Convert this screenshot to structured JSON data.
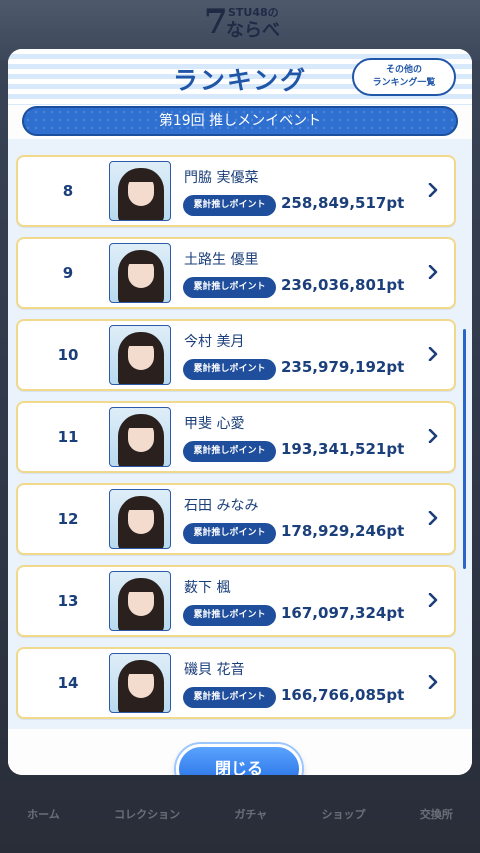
{
  "app": {
    "logo_small": "STU48の",
    "logo_number": "7",
    "logo_kana": "ならべ"
  },
  "bottom_nav": [
    {
      "label": "ホーム"
    },
    {
      "label": "コレクション"
    },
    {
      "label": "ガチャ"
    },
    {
      "label": "ショップ"
    },
    {
      "label": "交換所"
    }
  ],
  "modal": {
    "title": "ランキング",
    "other_ranking_line1": "その他の",
    "other_ranking_line2": "ランキング一覧",
    "event_name": "第19回 推しメンイベント",
    "close_label": "閉じる",
    "badge_label": "累計推しポイント"
  },
  "rankings": [
    {
      "rank": "8",
      "name": "門脇 実優菜",
      "points": "258,849,517pt"
    },
    {
      "rank": "9",
      "name": "土路生 優里",
      "points": "236,036,801pt"
    },
    {
      "rank": "10",
      "name": "今村 美月",
      "points": "235,979,192pt"
    },
    {
      "rank": "11",
      "name": "甲斐 心愛",
      "points": "193,341,521pt"
    },
    {
      "rank": "12",
      "name": "石田 みなみ",
      "points": "178,929,246pt"
    },
    {
      "rank": "13",
      "name": "薮下 楓",
      "points": "167,097,324pt"
    },
    {
      "rank": "14",
      "name": "磯貝 花音",
      "points": "166,766,085pt"
    }
  ],
  "colors": {
    "primary": "#1f56a8",
    "row_border": "#f1d98b",
    "close_button": "#1d68e0"
  },
  "icons": {
    "row_arrow": "chevron-right-icon"
  }
}
